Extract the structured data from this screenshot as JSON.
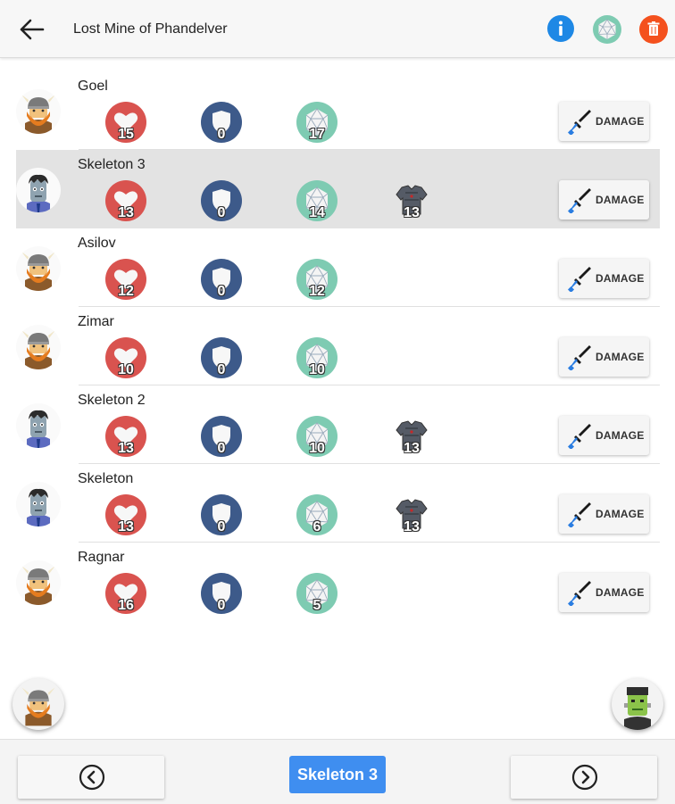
{
  "header": {
    "title": "Lost Mine of Phandelver",
    "icons": [
      "arrow-back-icon",
      "info-icon",
      "d20-dice-icon",
      "trash-icon"
    ],
    "colors": {
      "info": "#1e88e5",
      "dice": "#7ecbb2",
      "delete": "#f4511e"
    }
  },
  "damage_label": "DAMAGE",
  "rows": [
    {
      "name": "Goel",
      "type": "dwarf",
      "hp": "15",
      "shield": "0",
      "dice": "17",
      "armor": null,
      "selected": false
    },
    {
      "name": "Skeleton 3",
      "type": "zombie",
      "hp": "13",
      "shield": "0",
      "dice": "14",
      "armor": "13",
      "selected": true
    },
    {
      "name": "Asilov",
      "type": "dwarf",
      "hp": "12",
      "shield": "0",
      "dice": "12",
      "armor": null,
      "selected": false
    },
    {
      "name": "Zimar",
      "type": "dwarf",
      "hp": "10",
      "shield": "0",
      "dice": "10",
      "armor": null,
      "selected": false
    },
    {
      "name": "Skeleton 2",
      "type": "zombie",
      "hp": "13",
      "shield": "0",
      "dice": "10",
      "armor": "13",
      "selected": false
    },
    {
      "name": "Skeleton",
      "type": "zombie",
      "hp": "13",
      "shield": "0",
      "dice": "6",
      "armor": "13",
      "selected": false
    },
    {
      "name": "Ragnar",
      "type": "dwarf",
      "hp": "16",
      "shield": "0",
      "dice": "5",
      "armor": null,
      "selected": false
    }
  ],
  "colors": {
    "hp": "#d9534f",
    "shield": "#3d5a8a",
    "dice": "#7ecbb2",
    "armor": "#555b66",
    "selected_row": "#e3e3e3",
    "current_turn": "#3f8ef0"
  },
  "fabs": {
    "left": "add-player-fab",
    "right": "add-monster-fab"
  },
  "bottom": {
    "current": "Skeleton 3",
    "prev_icon": "chevron-left-circle-icon",
    "next_icon": "chevron-right-circle-icon"
  }
}
